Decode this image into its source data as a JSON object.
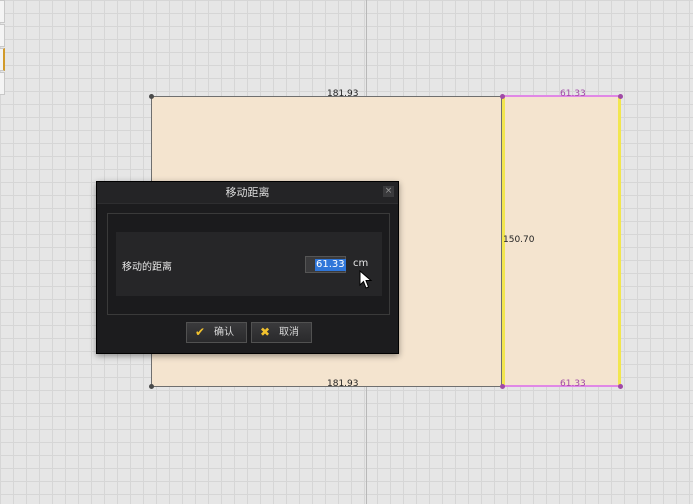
{
  "canvas": {
    "dimensions": {
      "top": "181.93",
      "bottom": "181.93",
      "panel_top": "61.33",
      "panel_bottom": "61.33",
      "height": "150.70"
    },
    "colors": {
      "room_fill": "#f4e4cf",
      "panel_edge": "#f2e64f",
      "selected_edge": "#e088e6"
    }
  },
  "dialog": {
    "title": "移动距离",
    "close_icon": "close-icon",
    "field_label": "移动的距离",
    "field_value": "61.33",
    "field_unit": "cm",
    "ok_label": "确认",
    "ok_icon": "checkmark-icon",
    "cancel_label": "取消",
    "cancel_icon": "x-icon",
    "accent_color": "#f2c22e",
    "selection_color": "#2f76d9"
  }
}
